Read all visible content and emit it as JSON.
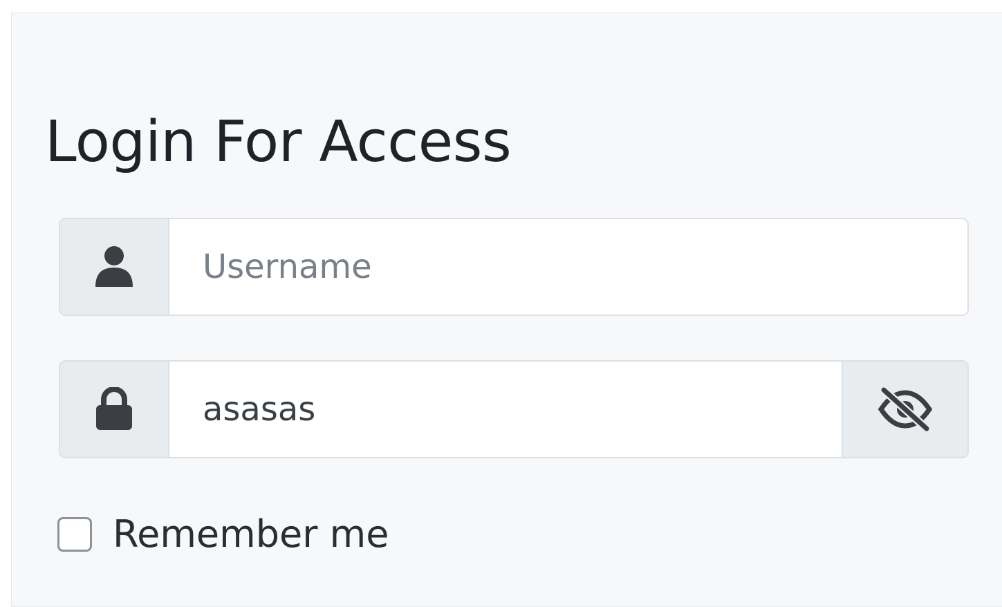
{
  "login": {
    "title": "Login For Access",
    "username": {
      "placeholder": "Username",
      "value": "",
      "icon": "user-icon"
    },
    "password": {
      "value": "asasas",
      "icon": "lock-icon",
      "toggle_icon": "eye-slash-icon"
    },
    "remember": {
      "label": "Remember me",
      "checked": false
    }
  },
  "colors": {
    "card_background": "#f7f8fa",
    "addon_background": "#e9ecef",
    "icon_color": "#3b3f44",
    "text_color": "#1f2226"
  }
}
